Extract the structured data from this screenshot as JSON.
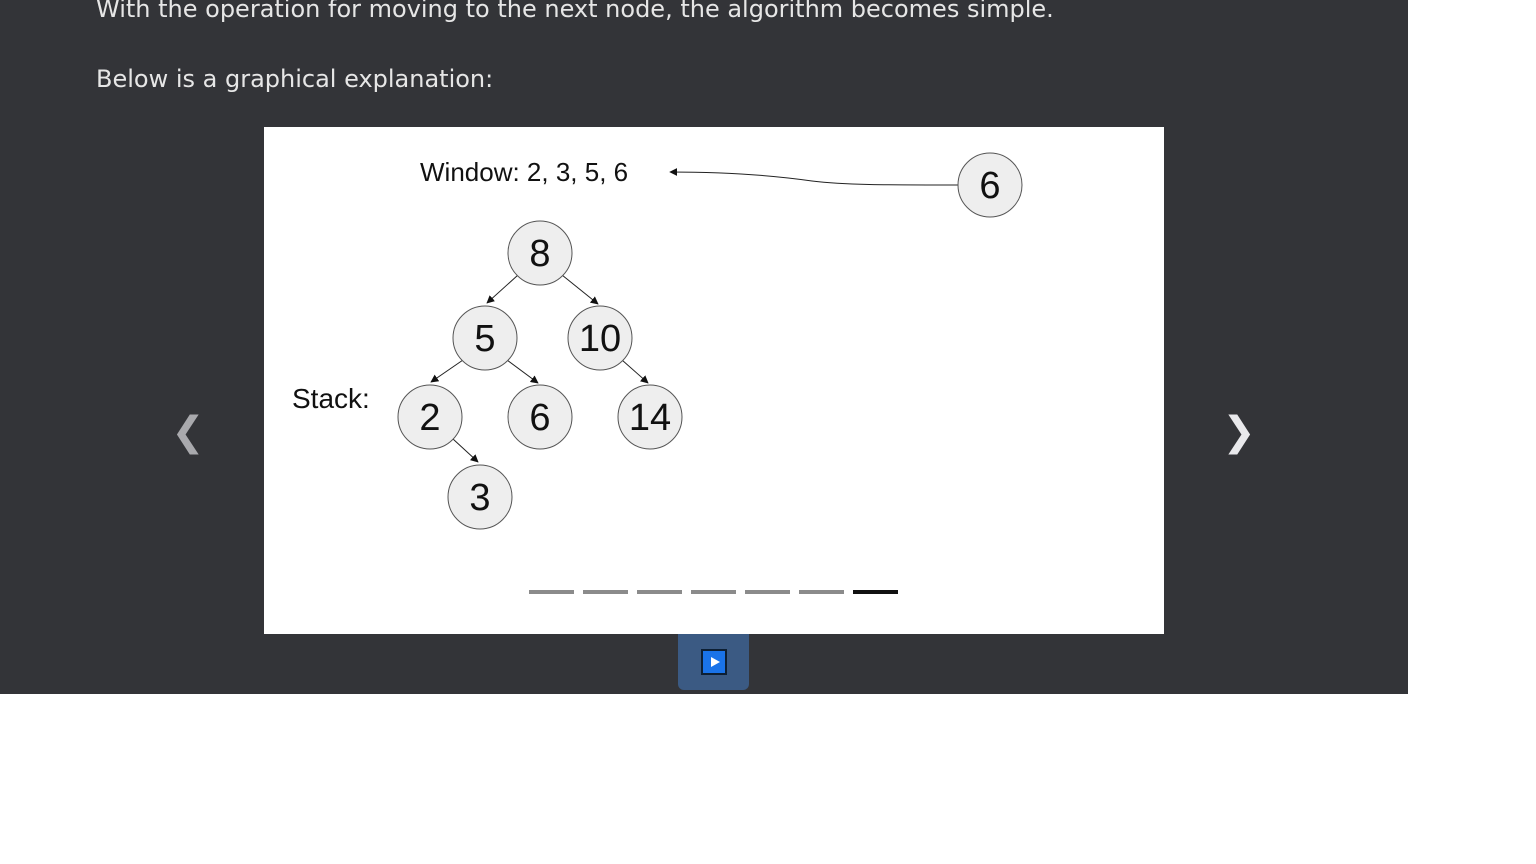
{
  "article": {
    "intro_text": "With the operation for moving to the next node, the algorithm becomes simple.",
    "explanation_text": "Below is a graphical explanation:"
  },
  "carousel": {
    "prev_label": "❮",
    "next_label": "❯",
    "slide_count": 7,
    "active_slide_index": 6,
    "play_icon": "play-icon"
  },
  "diagram": {
    "window_label": "Window: 2, 3, 5, 6",
    "stack_label": "Stack:",
    "incoming_node": "6",
    "tree": {
      "root": "8",
      "root_left": "5",
      "root_right": "10",
      "left_left": "2",
      "left_right": "6",
      "right_right": "14",
      "left_left_right": "3"
    }
  },
  "colors": {
    "panel_background": "#333438",
    "node_fill": "#eeeeee",
    "active_indicator": "#111111",
    "inactive_indicator": "#8b8b8b",
    "play_button": "#3b5a83"
  }
}
